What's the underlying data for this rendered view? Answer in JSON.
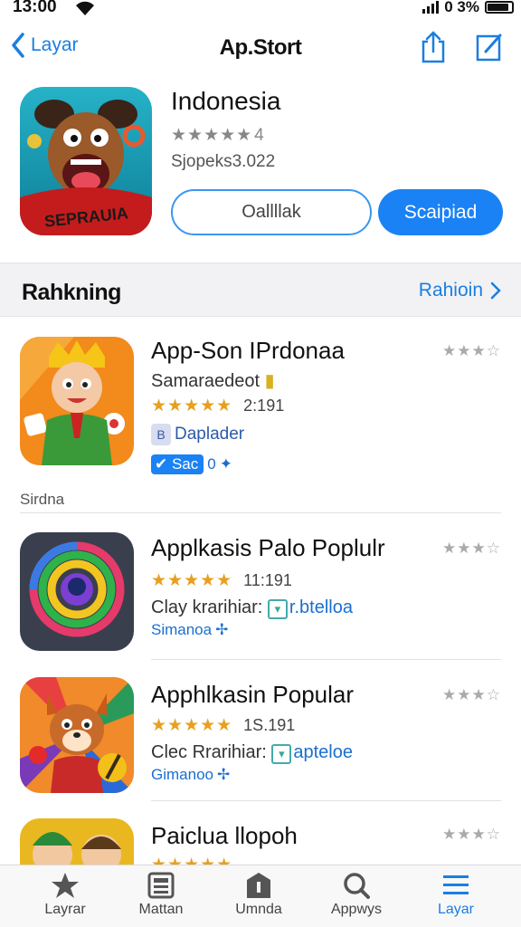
{
  "status": {
    "time": "13:00",
    "battery": "0 3%"
  },
  "nav": {
    "back_label": "Layar",
    "title": "Ap.Stort"
  },
  "hero": {
    "name": "Indonesia",
    "rating": "4",
    "subtitle": "Sjopeks3.022",
    "icon_text": "SEPRAUIA",
    "button_outline": "Oallllak",
    "button_primary": "Scaipiad"
  },
  "section": {
    "title": "Rahkning",
    "link": "Rahioin"
  },
  "apps": [
    {
      "title": "App-Son IPrdonaa",
      "line2": "Samaraedeot",
      "rating_count": "2:191",
      "line3": "Daplader",
      "line4": "Sac",
      "line4_suffix": "0",
      "category": "Sirdna"
    },
    {
      "title": "Applkasis Palo Poplulr",
      "rating_count": "11:191",
      "line2": "Clay krarihiar:",
      "line2_link": "r.btelloa",
      "line4": "Simanoa"
    },
    {
      "title": "Apphlkasin Popular",
      "rating_count": "1S.191",
      "line2": "Clec Rrarihiar:",
      "line2_link": "apteloe",
      "line4": "Gimanoo"
    },
    {
      "title": "Paiclua llopoh"
    }
  ],
  "tabs": [
    {
      "label": "Layrar",
      "icon": "star-icon"
    },
    {
      "label": "Mattan",
      "icon": "newspaper-icon"
    },
    {
      "label": "Umnda",
      "icon": "layers-icon"
    },
    {
      "label": "Appwys",
      "icon": "search-icon"
    },
    {
      "label": "Layar",
      "icon": "list-icon"
    }
  ],
  "colors": {
    "accent": "#1a82f5",
    "star": "#e6a020"
  }
}
